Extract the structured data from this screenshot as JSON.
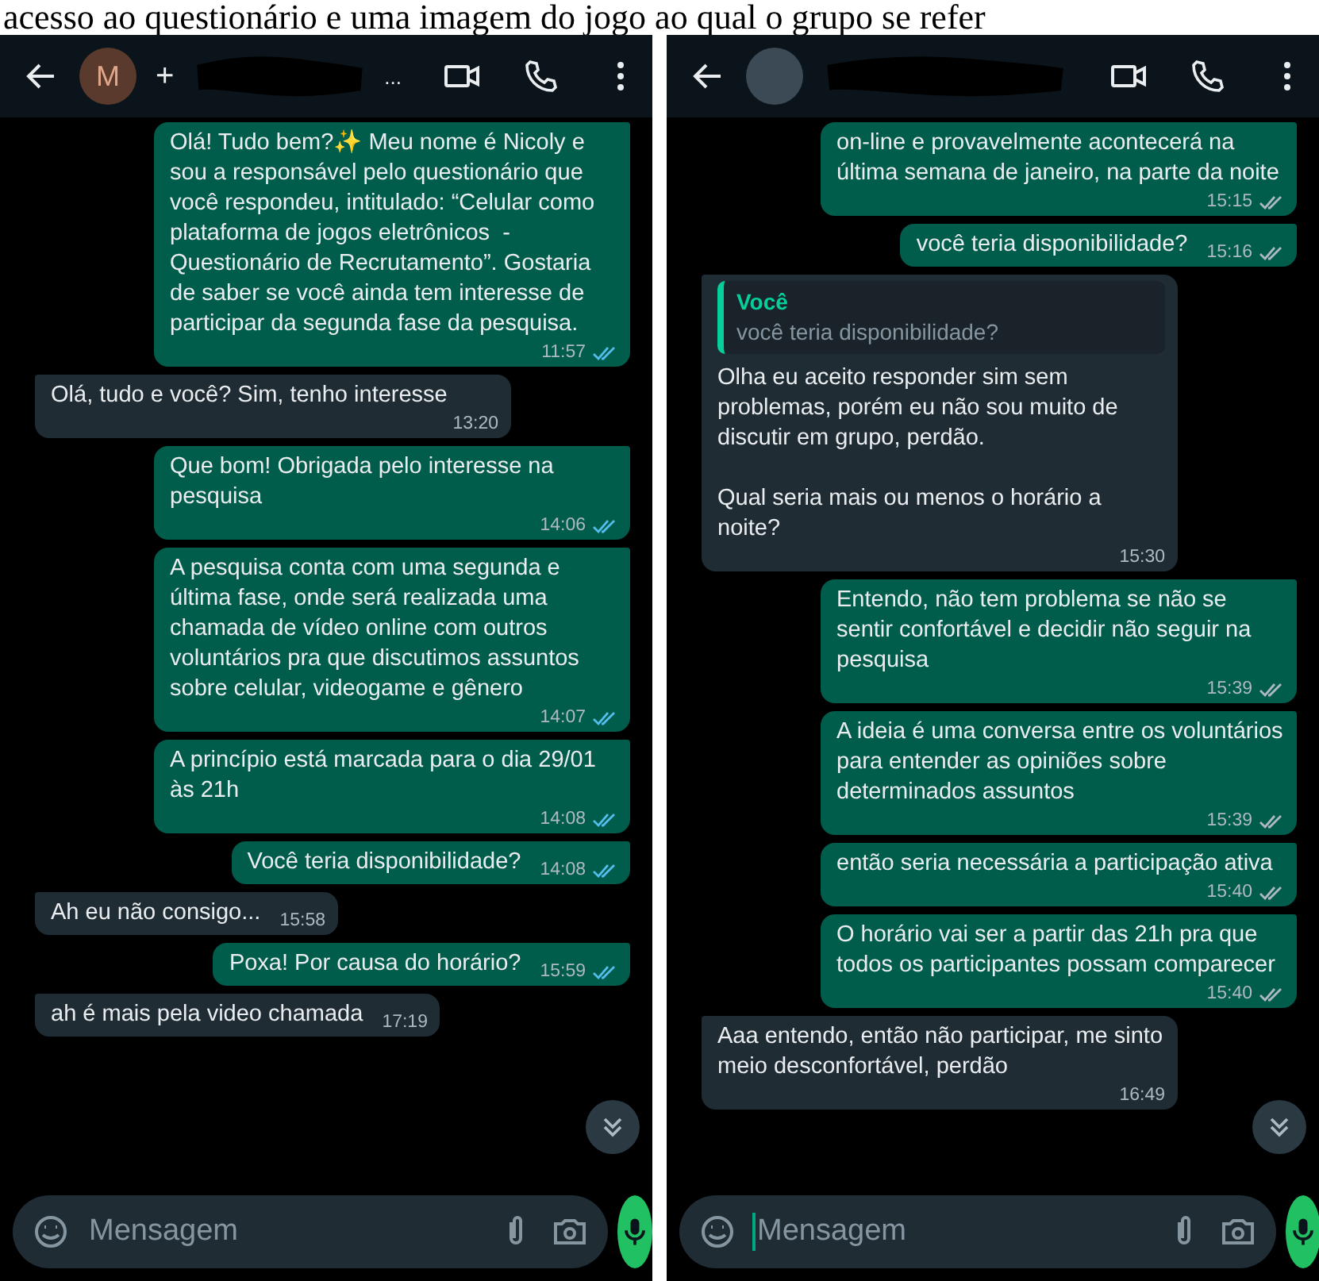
{
  "document_line": "acesso ao questionário e uma imagem do jogo ao qual o grupo se refer",
  "screens": [
    {
      "header": {
        "avatar_letter": "M",
        "name": "+",
        "name_more": "..."
      },
      "messages": [
        {
          "kind": "out",
          "text": "Olá! Tudo bem?✨ Meu nome é Nicoly e sou a responsável pelo questionário que você respondeu, intitulado: “Celular como plataforma de jogos eletrônicos  - Questionário de Recrutamento”. Gostaria de saber se você ainda tem interesse de participar da segunda fase da pesquisa.",
          "time": "11:57",
          "read": true
        },
        {
          "kind": "in",
          "text": "Olá, tudo e você? Sim, tenho interesse",
          "time": "13:20"
        },
        {
          "kind": "out",
          "text": "Que bom! Obrigada pelo interesse na pesquisa",
          "time": "14:06",
          "read": true
        },
        {
          "kind": "out",
          "text": "A pesquisa conta com uma segunda e última fase, onde será realizada uma chamada de vídeo online com outros voluntários pra que discutimos assuntos sobre celular, videogame e gênero",
          "time": "14:07",
          "read": true
        },
        {
          "kind": "out",
          "text": "A princípio está marcada para o dia 29/01 às 21h",
          "time": "14:08",
          "read": true
        },
        {
          "kind": "out",
          "text": "Você teria disponibilidade?",
          "time": "14:08",
          "read": true
        },
        {
          "kind": "in",
          "text": "Ah eu não consigo...",
          "time": "15:58"
        },
        {
          "kind": "out",
          "text": "Poxa! Por causa do horário?",
          "time": "15:59",
          "read": true
        },
        {
          "kind": "in",
          "text": "ah é mais pela video chamada",
          "time": "17:19"
        }
      ],
      "composer": {
        "placeholder": "Mensagem",
        "focused": false
      }
    },
    {
      "messages": [
        {
          "kind": "out",
          "text": "on-line e provavelmente acontecerá na última semana de janeiro, na parte da noite",
          "time": "15:15",
          "read": false
        },
        {
          "kind": "out",
          "text": "você teria disponibilidade?",
          "time": "15:16",
          "read": false
        },
        {
          "kind": "in",
          "quote": {
            "author": "Você",
            "text": "você teria disponibilidade?"
          },
          "text": "Olha eu aceito responder sim sem problemas, porém eu não sou muito de discutir em grupo, perdão.\n\nQual seria mais ou menos o horário a noite?",
          "time": "15:30"
        },
        {
          "kind": "out",
          "text": "Entendo, não tem problema se não se sentir confortável e decidir não seguir na pesquisa",
          "time": "15:39",
          "read": false
        },
        {
          "kind": "out",
          "text": "A ideia é uma conversa entre os voluntários para entender as opiniões sobre determinados assuntos",
          "time": "15:39",
          "read": false
        },
        {
          "kind": "out",
          "text": "então seria necessária a participação ativa",
          "time": "15:40",
          "read": false
        },
        {
          "kind": "out",
          "text": "O horário vai ser a partir das 21h pra que todos os participantes possam comparecer",
          "time": "15:40",
          "read": false
        },
        {
          "kind": "in",
          "text": "Aaa entendo, então não participar, me sinto meio desconfortável, perdão",
          "time": "16:49"
        }
      ],
      "composer": {
        "placeholder": "Mensagem",
        "focused": true
      }
    }
  ]
}
